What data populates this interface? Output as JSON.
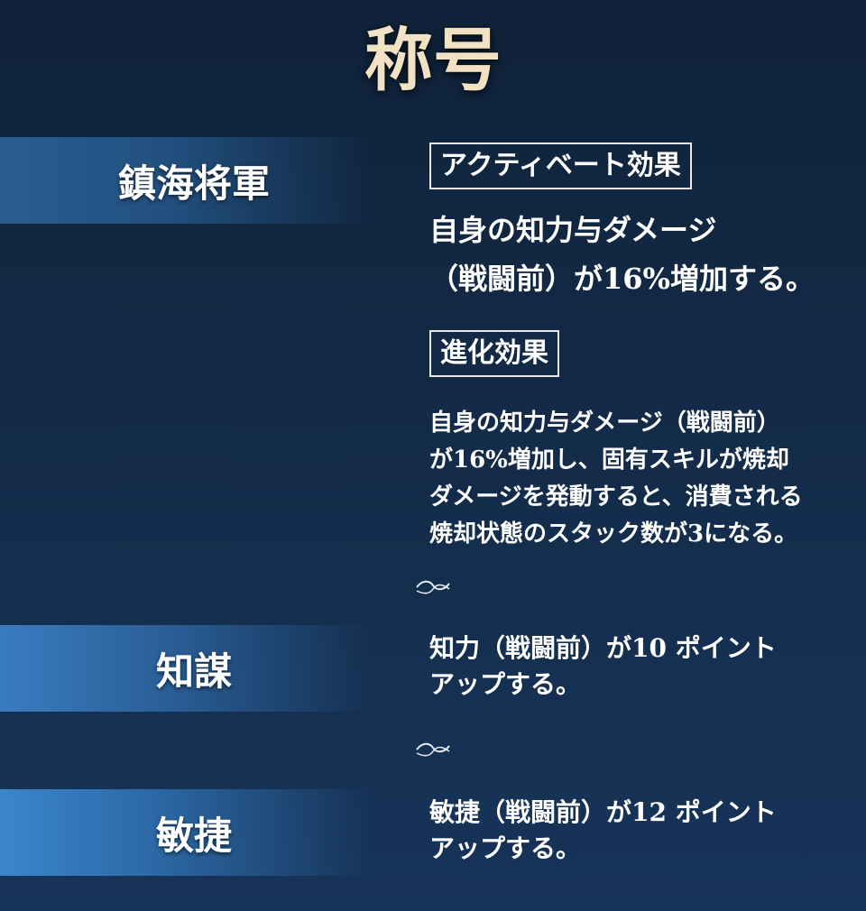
{
  "title": "称号",
  "sections": [
    {
      "name": "鎮海将軍",
      "active_label": "アクティベート効果",
      "active_lines": [
        "自身の知力与ダメージ",
        "（戦闘前）が16%増加する。"
      ],
      "evolve_label": "進化効果",
      "evolve_lines": [
        "自身の知力与ダメージ（戦闘前）",
        "が16%増加し、固有スキルが焼却",
        "ダメージを発動すると、消費される",
        "焼却状態のスタック数が3になる。"
      ]
    },
    {
      "name": "知謀",
      "lines": [
        "知力（戦闘前）が10 ポイント",
        "アップする。"
      ]
    },
    {
      "name": "敏捷",
      "lines": [
        "敏捷（戦闘前）が12 ポイント",
        "アップする。"
      ]
    }
  ],
  "colors": {
    "title": "#f1e2c6",
    "banner": "#2a5d92",
    "background": "#132b48",
    "border": "#e8e8e8"
  }
}
